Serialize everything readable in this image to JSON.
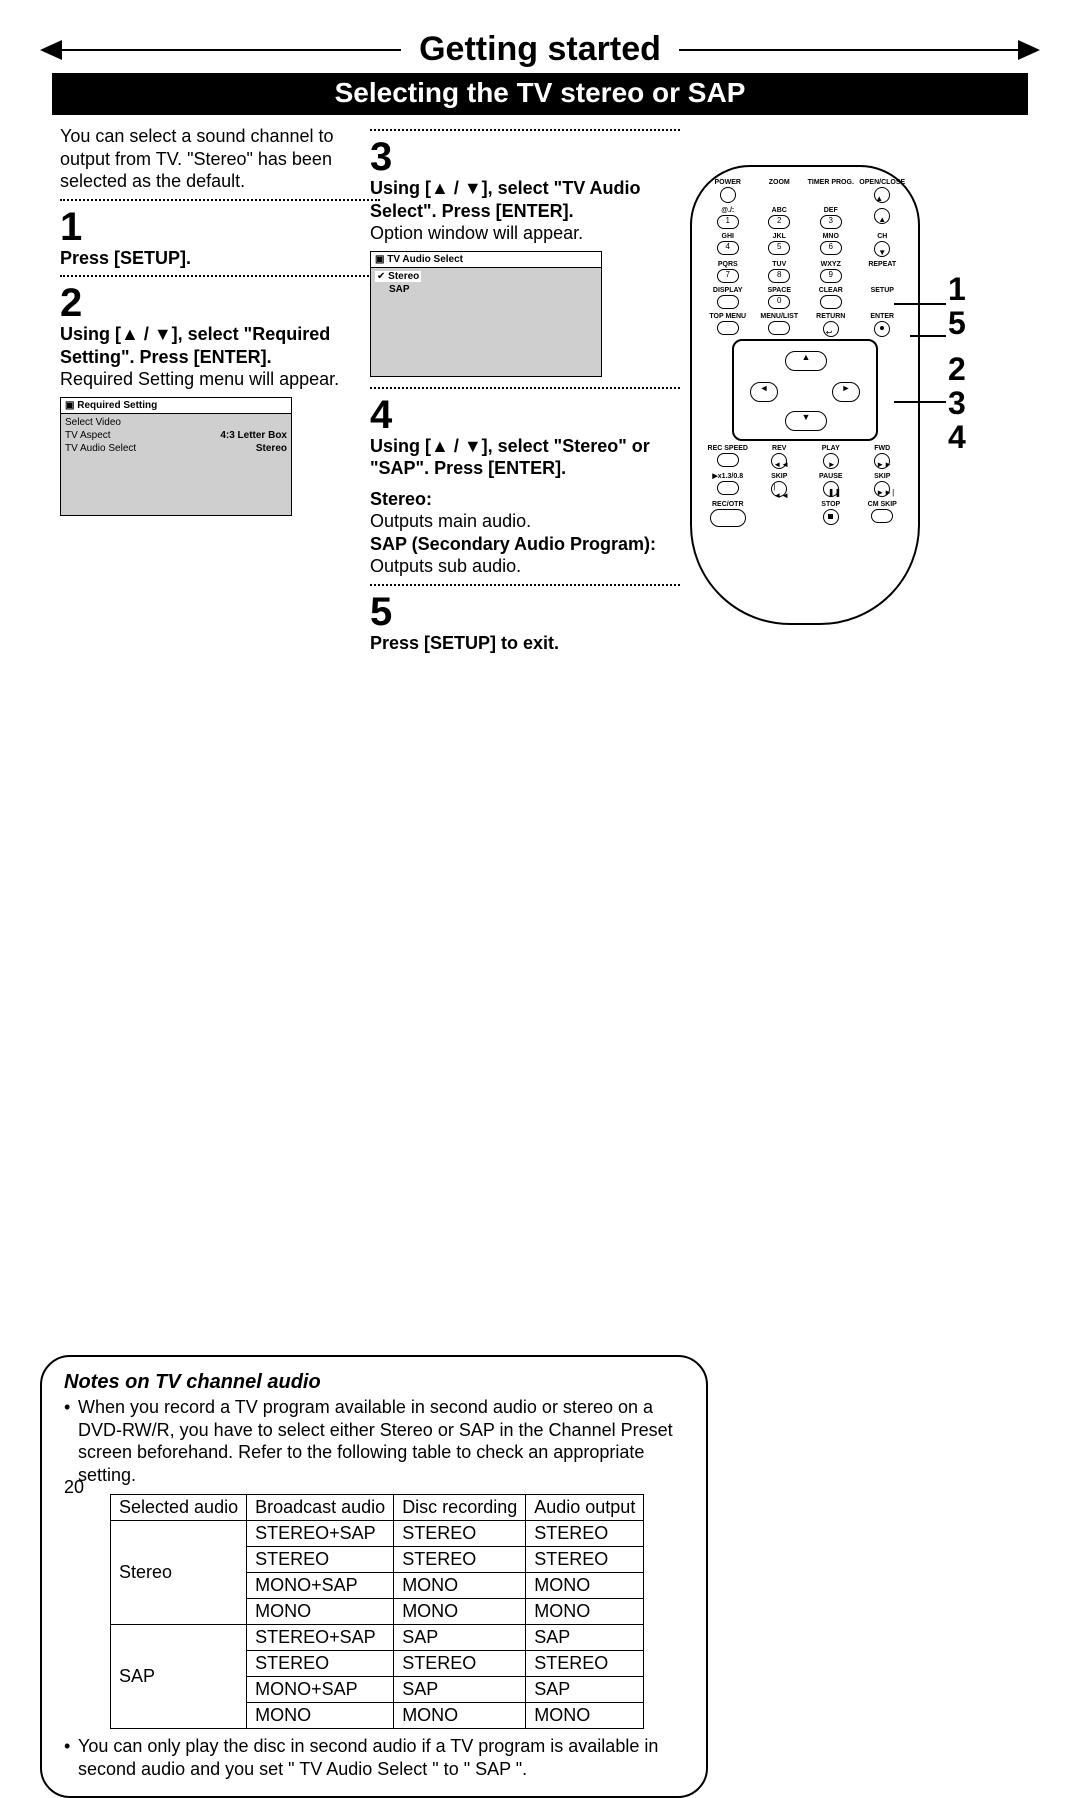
{
  "header": {
    "title": "Getting started",
    "subtitle": "Selecting the TV stereo or SAP"
  },
  "intro": "You can select a sound channel to output from TV.  \"Stereo\" has been selected as the default.",
  "step1": {
    "num": "1",
    "text": "Press [SETUP]."
  },
  "step2": {
    "num": "2",
    "bold": "Using [▲ / ▼], select \"Required Setting\". Press [ENTER].",
    "text": "Required Setting menu will appear.",
    "menu": {
      "title": "Required Setting",
      "rows": [
        {
          "l": "Select Video",
          "r": ""
        },
        {
          "l": "TV Aspect",
          "r": "4:3 Letter Box"
        },
        {
          "l": "TV Audio Select",
          "r": "Stereo"
        }
      ]
    }
  },
  "step3": {
    "num": "3",
    "bold": "Using [▲ / ▼], select \"TV Audio Select\". Press [ENTER].",
    "text": "Option window will appear.",
    "menu": {
      "title": "TV Audio Select",
      "rows": [
        {
          "l": "Stereo",
          "sel": true
        },
        {
          "l": "SAP"
        }
      ]
    }
  },
  "step4": {
    "num": "4",
    "bold": "Using [▲ / ▼], select \"Stereo\" or \"SAP\". Press [ENTER].",
    "stereo_label": "Stereo:",
    "stereo_text": "Outputs main audio.",
    "sap_label": "SAP (Secondary Audio Program):",
    "sap_text": "Outputs sub audio."
  },
  "step5": {
    "num": "5",
    "text": "Press [SETUP] to exit."
  },
  "notes": {
    "title": "Notes on TV channel audio",
    "b1": "When you record a TV program available in second audio or stereo on a DVD-RW/R, you have to select either Stereo or SAP in the Channel Preset screen beforehand. Refer to the following table to check an appropriate setting.",
    "b2": "You can only play the disc in second audio if a TV program is available in second audio and you set \" TV Audio Select \" to \" SAP \".",
    "table": {
      "headers": [
        "Selected audio",
        "Broadcast audio",
        "Disc recording",
        "Audio output"
      ],
      "rows": [
        [
          "Stereo",
          "STEREO+SAP",
          "STEREO",
          "STEREO"
        ],
        [
          "",
          "STEREO",
          "STEREO",
          "STEREO"
        ],
        [
          "",
          "MONO+SAP",
          "MONO",
          "MONO"
        ],
        [
          "",
          "MONO",
          "MONO",
          "MONO"
        ],
        [
          "SAP",
          "STEREO+SAP",
          "SAP",
          "SAP"
        ],
        [
          "",
          "STEREO",
          "STEREO",
          "STEREO"
        ],
        [
          "",
          "MONO+SAP",
          "SAP",
          "SAP"
        ],
        [
          "",
          "MONO",
          "MONO",
          "MONO"
        ]
      ]
    }
  },
  "remote": {
    "row1": [
      "POWER",
      "ZOOM",
      "TIMER PROG.",
      "OPEN/CLOSE"
    ],
    "numpad": [
      [
        "@./:",
        "ABC",
        "DEF",
        ""
      ],
      [
        "1",
        "2",
        "3",
        "▲"
      ],
      [
        "GHI",
        "JKL",
        "MNO",
        "CH"
      ],
      [
        "4",
        "5",
        "6",
        "▼"
      ],
      [
        "PQRS",
        "TUV",
        "WXYZ",
        "REPEAT"
      ],
      [
        "7",
        "8",
        "9",
        ""
      ],
      [
        "DISPLAY",
        "SPACE",
        "CLEAR",
        "SETUP"
      ],
      [
        "",
        "0",
        "",
        ""
      ]
    ],
    "row_menu": [
      "TOP MENU",
      "MENU/LIST",
      "RETURN",
      "ENTER"
    ],
    "transport1": [
      "REC SPEED",
      "REV",
      "PLAY",
      "FWD"
    ],
    "transport2": [
      "▶x1.3/0.8",
      "SKIP",
      "PAUSE",
      "SKIP"
    ],
    "transport3": [
      "REC/OTR",
      "",
      "STOP",
      "CM SKIP"
    ],
    "callouts": [
      "1",
      "5",
      "2",
      "3",
      "4"
    ]
  },
  "page_number": "20"
}
